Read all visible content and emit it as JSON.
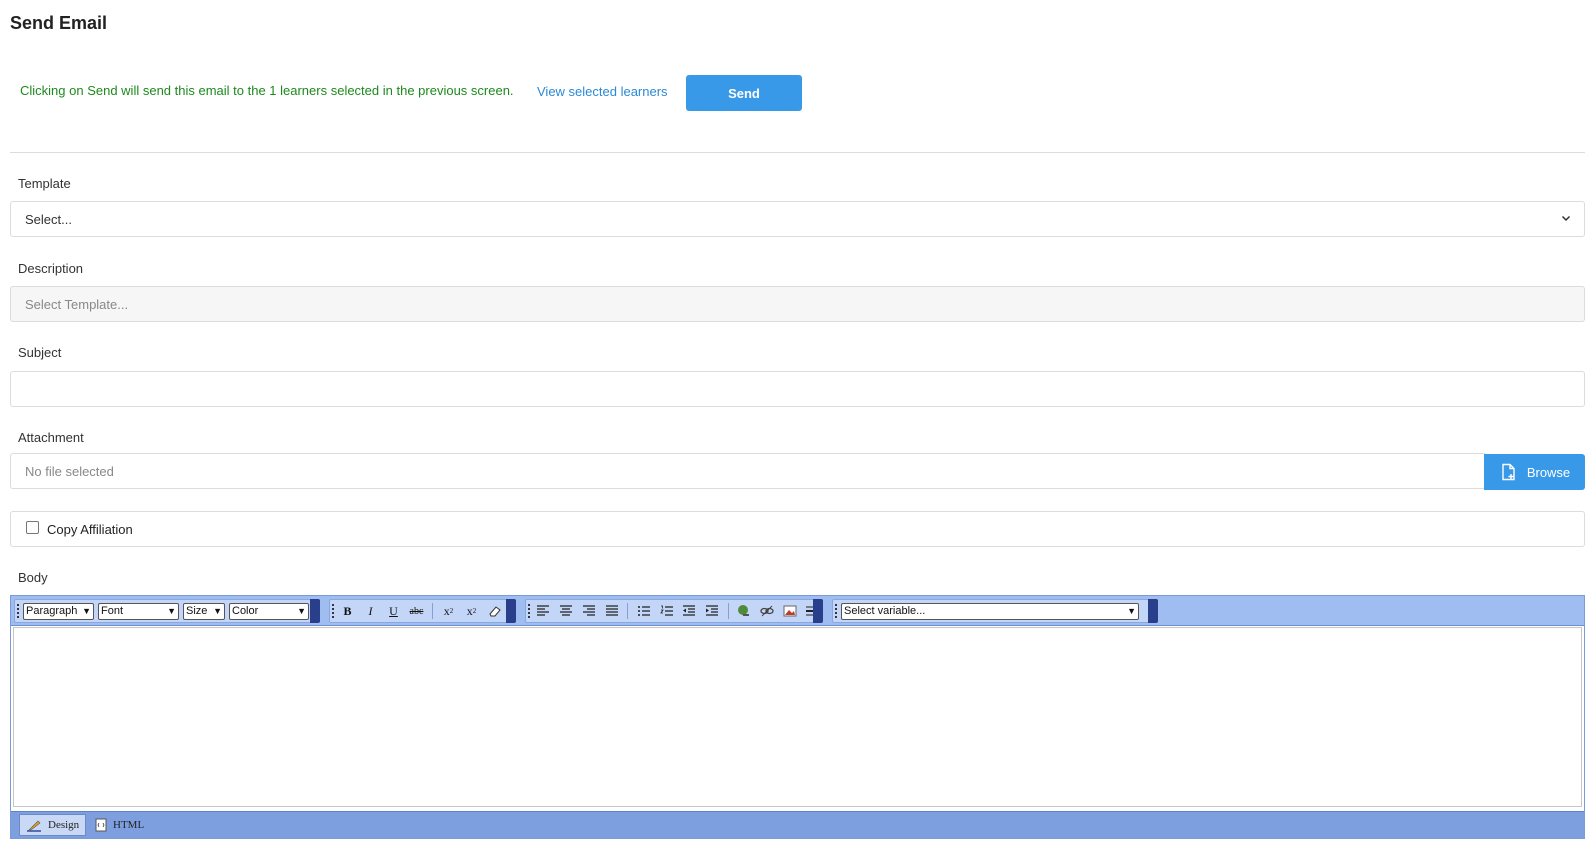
{
  "page": {
    "title": "Send Email"
  },
  "notice": {
    "message": "Clicking on Send will send this email to the 1 learners selected in the previous screen.",
    "view_link": "View selected learners",
    "send_label": "Send"
  },
  "form": {
    "template": {
      "label": "Template",
      "value": "Select..."
    },
    "description": {
      "label": "Description",
      "placeholder": "Select Template..."
    },
    "subject": {
      "label": "Subject",
      "value": ""
    },
    "attachment": {
      "label": "Attachment",
      "status": "No file selected",
      "browse_label": "Browse"
    },
    "copy_affiliation": {
      "label": "Copy Affiliation",
      "checked": false
    },
    "body": {
      "label": "Body"
    }
  },
  "editor": {
    "paragraph": "Paragraph",
    "font": "Font",
    "size": "Size",
    "color": "Color",
    "variable": "Select variable...",
    "modes": [
      {
        "label": "Design",
        "active": true
      },
      {
        "label": "HTML",
        "active": false
      }
    ],
    "toolbar_color": "#9fbdf1",
    "accent": "#3899e8"
  }
}
